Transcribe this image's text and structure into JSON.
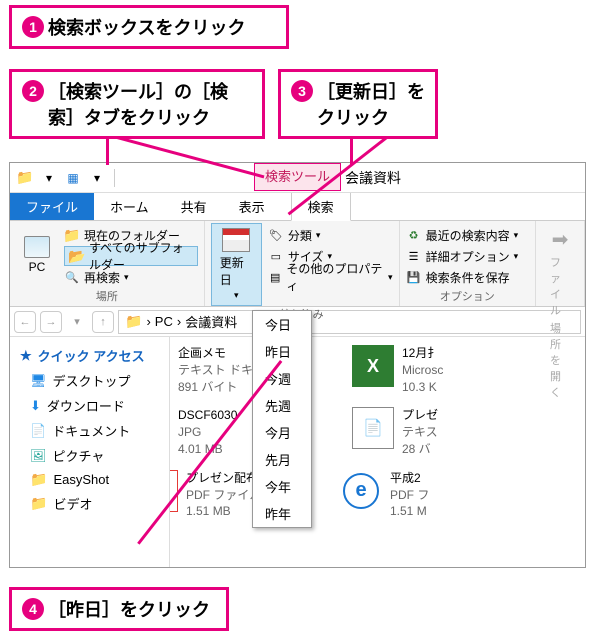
{
  "callouts": {
    "c1": "検索ボックスをクリック",
    "c2": "［検索ツール］の［検索］タブをクリック",
    "c3": "［更新日］をクリック",
    "c4": "［昨日］をクリック"
  },
  "titlebar": {
    "toolTab": "検索ツール",
    "winTitle": "会議資料"
  },
  "tabs": {
    "file": "ファイル",
    "home": "ホーム",
    "share": "共有",
    "view": "表示",
    "search": "検索"
  },
  "ribbon": {
    "place": {
      "pcLabel": "PC",
      "currentFolder": "現在のフォルダー",
      "allSub": "すべてのサブフォルダー",
      "reSearch": "再検索",
      "group": "場所"
    },
    "refine": {
      "updateDate": "更新日",
      "kind": "分類",
      "size": "サイズ",
      "other": "その他のプロパティ",
      "group": "絞り込み"
    },
    "options": {
      "recent": "最近の検索内容",
      "advanced": "詳細オプション",
      "save": "検索条件を保存",
      "group": "オプション"
    },
    "close": {
      "fileOpen": "ファイル",
      "location": "場所を開く"
    }
  },
  "dateMenu": [
    "今日",
    "昨日",
    "今週",
    "先週",
    "今月",
    "先月",
    "今年",
    "昨年"
  ],
  "breadcrumb": {
    "pc": "PC",
    "sep": "›",
    "folder": "会議資料"
  },
  "nav": {
    "quick": "クイック アクセス",
    "desktop": "デスクトップ",
    "downloads": "ダウンロード",
    "documents": "ドキュメント",
    "pictures": "ピクチャ",
    "easyshot": "EasyShot",
    "videos": "ビデオ"
  },
  "files": [
    {
      "name": "企画メモ",
      "type": "テキスト ドキュメント",
      "size": "891 バイト",
      "icon": "txt"
    },
    {
      "name": "12月扌",
      "type": "Microsc",
      "size": "10.3 K",
      "icon": "xls"
    },
    {
      "name": "DSCF6030",
      "type": "JPG",
      "size": "4.01 MB",
      "icon": "img"
    },
    {
      "name": "プレゼ",
      "type": "テキス",
      "size": "28 バ",
      "icon": "txt"
    },
    {
      "name": "プレゼン配布資料",
      "type": "PDF ファイル",
      "size": "1.51 MB",
      "icon": "pdf"
    },
    {
      "name": "平成2",
      "type": "PDF フ",
      "size": "1.51 M",
      "icon": "ie"
    }
  ]
}
